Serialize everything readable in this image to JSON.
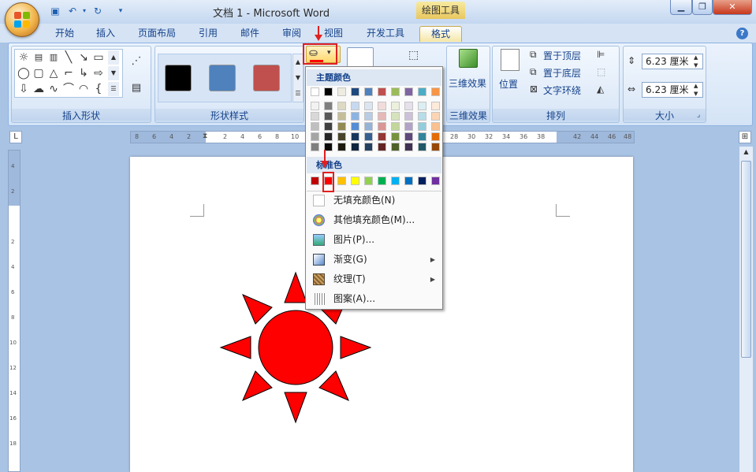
{
  "titlebar": {
    "title": "文档 1 - Microsoft Word",
    "context_tab": "绘图工具",
    "quick_access": [
      "save-icon",
      "undo-icon",
      "redo-icon",
      "customize-icon"
    ]
  },
  "tabs": [
    "开始",
    "插入",
    "页面布局",
    "引用",
    "邮件",
    "审阅",
    "视图",
    "开发工具",
    "格式"
  ],
  "active_tab": "格式",
  "ribbon": {
    "groups": [
      "插入形状",
      "形状样式",
      "三维效果",
      "排列",
      "大小"
    ],
    "three_d_label": "三维效果",
    "arrange": {
      "position": "位置",
      "bring_front": "置于顶层",
      "send_back": "置于底层",
      "text_wrap": "文字环绕"
    },
    "size": {
      "height": "6.23 厘米",
      "width": "6.23 厘米"
    }
  },
  "style_colors": [
    "#000000",
    "#4f81bd",
    "#c0504d"
  ],
  "ruler": {
    "h_ticks": [
      "8",
      "6",
      "4",
      "2",
      "2",
      "4",
      "6",
      "8",
      "10",
      "28",
      "30",
      "32",
      "34",
      "36",
      "38",
      "42",
      "44",
      "46",
      "48"
    ],
    "v_ticks": [
      "4",
      "2",
      "2",
      "4",
      "6",
      "8",
      "10",
      "12",
      "14",
      "16",
      "18"
    ]
  },
  "fill_menu": {
    "theme_header": "主题颜色",
    "theme_top": [
      "#ffffff",
      "#000000",
      "#eeece1",
      "#1f497d",
      "#4f81bd",
      "#c0504d",
      "#9bbb59",
      "#8064a2",
      "#4bacc6",
      "#f79646"
    ],
    "theme_shades": [
      [
        "#f2f2f2",
        "#7f7f7f",
        "#ddd9c3",
        "#c6d9f0",
        "#dbe5f1",
        "#f2dcdb",
        "#ebf1dd",
        "#e5e0ec",
        "#dbeef3",
        "#fdeada"
      ],
      [
        "#d8d8d8",
        "#595959",
        "#c4bd97",
        "#8db3e2",
        "#b8cce4",
        "#e5b9b7",
        "#d7e3bc",
        "#ccc1d9",
        "#b7dde8",
        "#fbd5b5"
      ],
      [
        "#bfbfbf",
        "#3f3f3f",
        "#938953",
        "#548dd4",
        "#95b3d7",
        "#d99694",
        "#c3d69b",
        "#b2a2c7",
        "#92cddc",
        "#fac08f"
      ],
      [
        "#a5a5a5",
        "#262626",
        "#494429",
        "#17365d",
        "#366092",
        "#953734",
        "#76923c",
        "#5f497a",
        "#31859b",
        "#e36c09"
      ],
      [
        "#7f7f7f",
        "#0c0c0c",
        "#1d1b10",
        "#0f243e",
        "#244061",
        "#632423",
        "#4f6128",
        "#3f3151",
        "#205867",
        "#974806"
      ]
    ],
    "standard_header": "标准色",
    "standard": [
      "#c00000",
      "#ff0000",
      "#ffc000",
      "#ffff00",
      "#92d050",
      "#00b050",
      "#00b0f0",
      "#0070c0",
      "#002060",
      "#7030a0"
    ],
    "items": [
      {
        "label": "无填充颜色(N)",
        "icon": "no-fill-icon",
        "submenu": false
      },
      {
        "label": "其他填充颜色(M)...",
        "icon": "palette-icon",
        "submenu": false
      },
      {
        "label": "图片(P)...",
        "icon": "picture-icon",
        "submenu": false
      },
      {
        "label": "渐变(G)",
        "icon": "gradient-icon",
        "submenu": true
      },
      {
        "label": "纹理(T)",
        "icon": "texture-icon",
        "submenu": true
      },
      {
        "label": "图案(A)...",
        "icon": "pattern-icon",
        "submenu": false
      }
    ]
  },
  "shape_fill_color": "#ff0000"
}
